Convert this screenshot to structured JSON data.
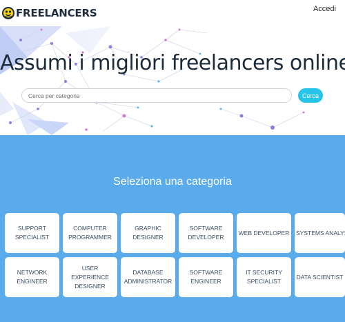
{
  "header": {
    "logo_text": "FREELANCERS",
    "login_label": "Accedi"
  },
  "hero": {
    "title": "Assumi i migliori freelancers online",
    "search_placeholder": "Cerca per categoria",
    "search_button_label": "Cerca"
  },
  "categories": {
    "title": "Seleziona una categoria",
    "items": [
      {
        "label": "SUPPORT\nSPECIALIST"
      },
      {
        "label": "COMPUTER\nPROGRAMMER"
      },
      {
        "label": "GRAPHIC\nDESIGNER"
      },
      {
        "label": "SOFTWARE\nDEVELOPER"
      },
      {
        "label": "WEB DEVELOPER"
      },
      {
        "label": "SYSTEMS ANALYST"
      },
      {
        "label": "NETWORK\nENGINEER"
      },
      {
        "label": "USER EXPERIENCE\nDESIGNER"
      },
      {
        "label": "DATABASE\nADMINISTRATOR"
      },
      {
        "label": "SOFTWARE\nENGINEER"
      },
      {
        "label": "IT SECURITY\nSPECIALIST"
      },
      {
        "label": "DATA SCIENTIST"
      }
    ]
  },
  "colors": {
    "brand_dark": "#1f2c3d",
    "accent_cyan": "#26c4ea",
    "section_blue": "#5aabeb",
    "logo_yellow": "#f4d21a"
  },
  "icons": {
    "logo": "freelancers-logo-icon"
  }
}
